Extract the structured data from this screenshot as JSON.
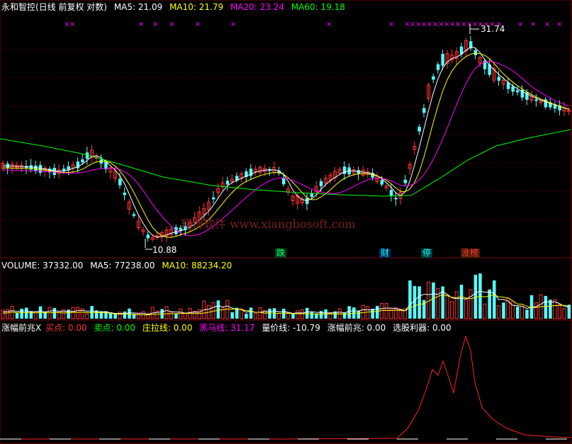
{
  "main": {
    "title": "永和智控(日线 前复权 对数)",
    "ma_items": [
      {
        "label": "MA5: 21.09",
        "color": "#ffffff"
      },
      {
        "label": "MA10: 21.79",
        "color": "#ffff00"
      },
      {
        "label": "MA20: 23.24",
        "color": "#ff00ff"
      },
      {
        "label": "MA60: 19.18",
        "color": "#00ff00"
      }
    ],
    "high_label": "31.74",
    "low_label": "10.88",
    "watermark": "翔博软件 www.xiangbosoft.com",
    "badges": [
      {
        "text": "跌",
        "color": "#00ff66",
        "bg": "#004d1f"
      },
      {
        "text": "财",
        "color": "#00ffff",
        "bg": "#003366"
      },
      {
        "text": "停",
        "color": "#00ffff",
        "bg": "#004d4d"
      },
      {
        "text": "涨",
        "color": "#ff3333",
        "bg": "#552200"
      },
      {
        "text": "榜",
        "color": "#ff3333",
        "bg": "#552200"
      }
    ]
  },
  "volume": {
    "items": [
      {
        "label": "VOLUME: 37332.00",
        "color": "#ffffff"
      },
      {
        "label": "MA5: 77238.00",
        "color": "#ffffff"
      },
      {
        "label": "MA10: 88234.20",
        "color": "#ffff00"
      }
    ]
  },
  "indicator": {
    "items": [
      {
        "label": "涨幅前兆X",
        "color": "#ffffff"
      },
      {
        "label": "买点: 0.00",
        "color": "#ff3333"
      },
      {
        "label": "卖点: 0.00",
        "color": "#00ff00"
      },
      {
        "label": "庄拉线: 0.00",
        "color": "#ffff00"
      },
      {
        "label": "黑马线: 31.17",
        "color": "#ff00ff"
      },
      {
        "label": "量价线: -10.79",
        "color": "#ffffff"
      },
      {
        "label": "涨幅前兆: 0.00",
        "color": "#ffffff"
      },
      {
        "label": "选股利器: 0.00",
        "color": "#ffffff"
      }
    ]
  },
  "colors": {
    "up": "#ff3333",
    "down": "#54ffff",
    "ma5": "#ffffff",
    "ma10": "#ffff00",
    "ma20": "#ff00ff",
    "ma60": "#00ff00",
    "grid": "#7a0000",
    "signal": "#ff00ff"
  }
}
